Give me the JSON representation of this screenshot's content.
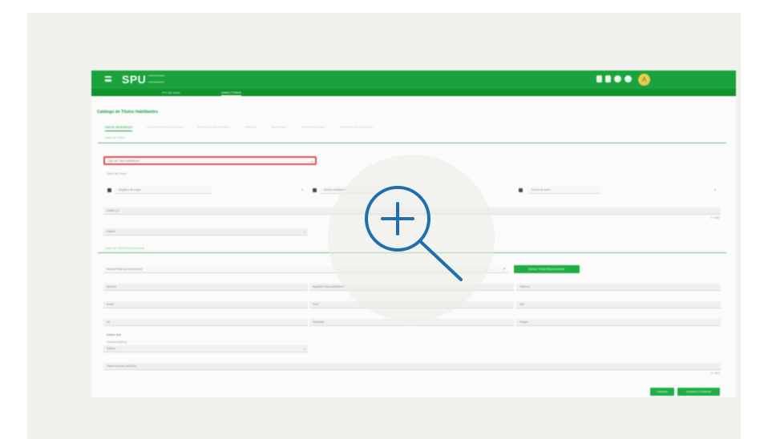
{
  "app": {
    "logo": "SPU",
    "avatar_initial": "A",
    "subnav": [
      "PIT DE Gest",
      "DIRECTORIO"
    ]
  },
  "page": {
    "title": "Catálogo de Títulos Habilitantes"
  },
  "tabs": [
    {
      "label": "DATOS GENERALES",
      "active": true
    },
    {
      "label": "DOCUMENTOS ADJUNTOS",
      "active": false
    },
    {
      "label": "INFORMACIÓN TÉCNICA",
      "active": false
    },
    {
      "label": "PREDIOS",
      "active": false
    },
    {
      "label": "INFORMES",
      "active": false
    },
    {
      "label": "OBSERVACIONES",
      "active": false
    },
    {
      "label": "HISTORIAL DE ESTADOS",
      "active": false
    }
  ],
  "sections": {
    "general": "Datos del Título",
    "contact": "Datos del Titular/Representante"
  },
  "fields": {
    "selected_title_type": "Tipo de Título Habilitante",
    "subtitle": "Datos del Título",
    "check_1": "Registro de Legal",
    "check_2": "Norma Habilitante",
    "check_3": "Fecha de Inicio",
    "observaciones": "Objeto (1)",
    "estado": "Estado",
    "titular_search": "Buscar titular por documento",
    "nombre": "Nombre",
    "apellido": "Apellido Paterno/Materno",
    "telefono": "Teléfono",
    "email": "Email",
    "ruc": "RUC",
    "dni": "DNI",
    "dir": "Dir",
    "domicilio": "Domicilio",
    "ubigeo": "Ubigeo",
    "estado_civil": "Estado civil",
    "otros_label": "Persona Natural",
    "otros_value": "Soltero",
    "notas": "Observaciones del título",
    "counter_1": "0 / 500",
    "counter_2": "0 / 500"
  },
  "buttons": {
    "search_titular": "Buscar Titular/Representante",
    "cancel": "Cancelar",
    "save": "Guardar y Continuar"
  },
  "colors": {
    "primary": "#1aa33c",
    "highlight": "#e25252",
    "zoom": "#1f6fb0"
  },
  "icons": {
    "zoom": "zoom-in-icon"
  }
}
